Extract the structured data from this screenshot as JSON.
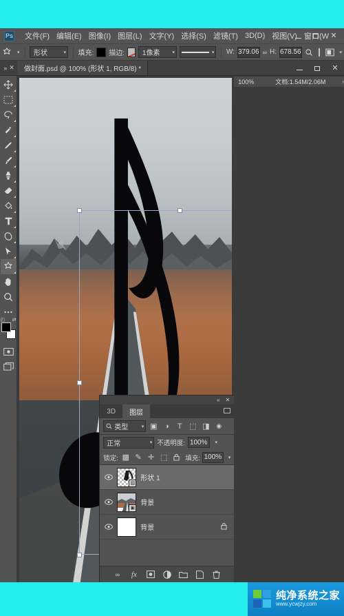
{
  "app": {
    "logo": "Ps",
    "menu": [
      {
        "label": "文件(F)",
        "name": "menu-file"
      },
      {
        "label": "编辑(E)",
        "name": "menu-edit"
      },
      {
        "label": "图像(I)",
        "name": "menu-image"
      },
      {
        "label": "图层(L)",
        "name": "menu-layer"
      },
      {
        "label": "文字(Y)",
        "name": "menu-type"
      },
      {
        "label": "选择(S)",
        "name": "menu-select"
      },
      {
        "label": "滤镜(T)",
        "name": "menu-filter"
      },
      {
        "label": "3D(D)",
        "name": "menu-3d"
      },
      {
        "label": "视图(V)",
        "name": "menu-view"
      },
      {
        "label": "窗口(W",
        "name": "menu-window"
      }
    ],
    "window_buttons": {
      "minimize": "–",
      "maximize": "□",
      "close": "✕"
    }
  },
  "options_bar": {
    "tool_icon": "custom-shape-icon",
    "mode_value": "形状",
    "fill_label": "填充:",
    "fill_color": "#000000",
    "stroke_label": "描边:",
    "stroke_width_value": "1像素",
    "stroke_style": "solid-line",
    "width_label": "W:",
    "width_value": "379.06",
    "link_icon": "link-chain-icon",
    "height_label": "H:",
    "height_value": "678.56",
    "align_icon": "path-align-icon",
    "arrange_icon": "path-arrange-icon"
  },
  "tabbar": {
    "document_title": "做封面.psd @ 100% (形状 1, RGB/8) *",
    "window_buttons": {
      "minimize": "–",
      "maximize": "□",
      "close": "✕"
    }
  },
  "toolbar": {
    "items": [
      {
        "name": "move-tool",
        "icon": "move-icon"
      },
      {
        "name": "marquee-tool",
        "icon": "rectangular-marquee-icon"
      },
      {
        "name": "lasso-tool",
        "icon": "lasso-icon"
      },
      {
        "name": "quick-selection-tool",
        "icon": "quick-selection-icon"
      },
      {
        "name": "eyedropper-tool",
        "icon": "eyedropper-icon"
      },
      {
        "name": "brush-tool",
        "icon": "brush-icon"
      },
      {
        "name": "clone-stamp-tool",
        "icon": "clone-stamp-icon"
      },
      {
        "name": "eraser-tool",
        "icon": "eraser-icon"
      },
      {
        "name": "paint-bucket-tool",
        "icon": "paint-bucket-icon"
      },
      {
        "name": "type-tool",
        "icon": "type-t-icon"
      },
      {
        "name": "pen-tool",
        "icon": "pen-icon"
      },
      {
        "name": "path-selection-tool",
        "icon": "path-arrow-icon"
      },
      {
        "name": "custom-shape-tool",
        "icon": "custom-shape-icon"
      },
      {
        "name": "hand-tool",
        "icon": "hand-icon"
      },
      {
        "name": "zoom-tool",
        "icon": "magnifier-icon"
      },
      {
        "name": "edit-toolbar-button",
        "icon": "ellipsis-icon"
      }
    ],
    "foreground_color": "#000000",
    "background_color": "#ffffff",
    "quick-mask": "quick-mask-icon",
    "screen-mode": "screen-mode-icon"
  },
  "canvas": {
    "selection": {
      "handles": 8,
      "border_color": "#9aa8c8"
    },
    "cursor": {
      "color": "#f51f8f",
      "icon": "arrow-cursor-icon"
    }
  },
  "layers_panel": {
    "collapse_icon": "collapse-icon",
    "close_icon": "close-icon",
    "tabs": [
      {
        "label": "3D",
        "name": "tab-3d",
        "active": false
      },
      {
        "label": "图层",
        "name": "tab-layers",
        "active": true
      }
    ],
    "panel_menu_icon": "panel-menu-icon",
    "filter": {
      "search_icon": "search-icon",
      "type_value": "类型",
      "icons": [
        {
          "name": "filter-pixel-icon",
          "glyph": "▣"
        },
        {
          "name": "filter-adjustment-icon",
          "glyph": "◑"
        },
        {
          "name": "filter-type-icon",
          "glyph": "T"
        },
        {
          "name": "filter-shape-icon",
          "glyph": "⬚"
        },
        {
          "name": "filter-smart-object-icon",
          "glyph": "◨"
        }
      ],
      "toggle_icon": "filter-toggle-icon"
    },
    "blend_mode": "正常",
    "opacity_label": "不透明度:",
    "opacity_value": "100%",
    "lock_label": "锁定:",
    "lock_icons": [
      {
        "name": "lock-transparent-pixels-icon",
        "glyph": "▩"
      },
      {
        "name": "lock-image-pixels-icon",
        "glyph": "✎"
      },
      {
        "name": "lock-position-icon",
        "glyph": "✛"
      },
      {
        "name": "lock-artboard-icon",
        "glyph": "⬚"
      },
      {
        "name": "lock-all-icon",
        "glyph": "🔒"
      }
    ],
    "fill_label": "填充:",
    "fill_value": "100%",
    "layers": [
      {
        "name": "形状 1",
        "visible": true,
        "selected": true,
        "thumb": "shape-vector-thumb",
        "locked": false
      },
      {
        "name": "背景",
        "visible": true,
        "selected": false,
        "thumb": "photo-thumb",
        "locked": false
      },
      {
        "name": "背景",
        "visible": true,
        "selected": false,
        "thumb": "white-thumb",
        "locked": true
      }
    ],
    "footer_icons": [
      {
        "name": "link-layers-button",
        "glyph": "∞"
      },
      {
        "name": "layer-style-button",
        "glyph": "fx"
      },
      {
        "name": "layer-mask-button",
        "glyph": "▣"
      },
      {
        "name": "adjustment-layer-button",
        "glyph": "◕"
      },
      {
        "name": "new-group-button",
        "glyph": "▭"
      },
      {
        "name": "new-layer-button",
        "glyph": "◳"
      },
      {
        "name": "delete-layer-button",
        "glyph": "🗑"
      }
    ]
  },
  "status_bar": {
    "zoom": "100%",
    "doc_info": "文档:1.54M/2.06M",
    "expand_icon": "›"
  },
  "watermark": {
    "title": "纯净系统之家",
    "url": "www.ycwjzy.com",
    "colors": [
      "#6ecb3a",
      "#2f9fe0",
      "#1f63b8",
      "#3cc0ea"
    ]
  }
}
